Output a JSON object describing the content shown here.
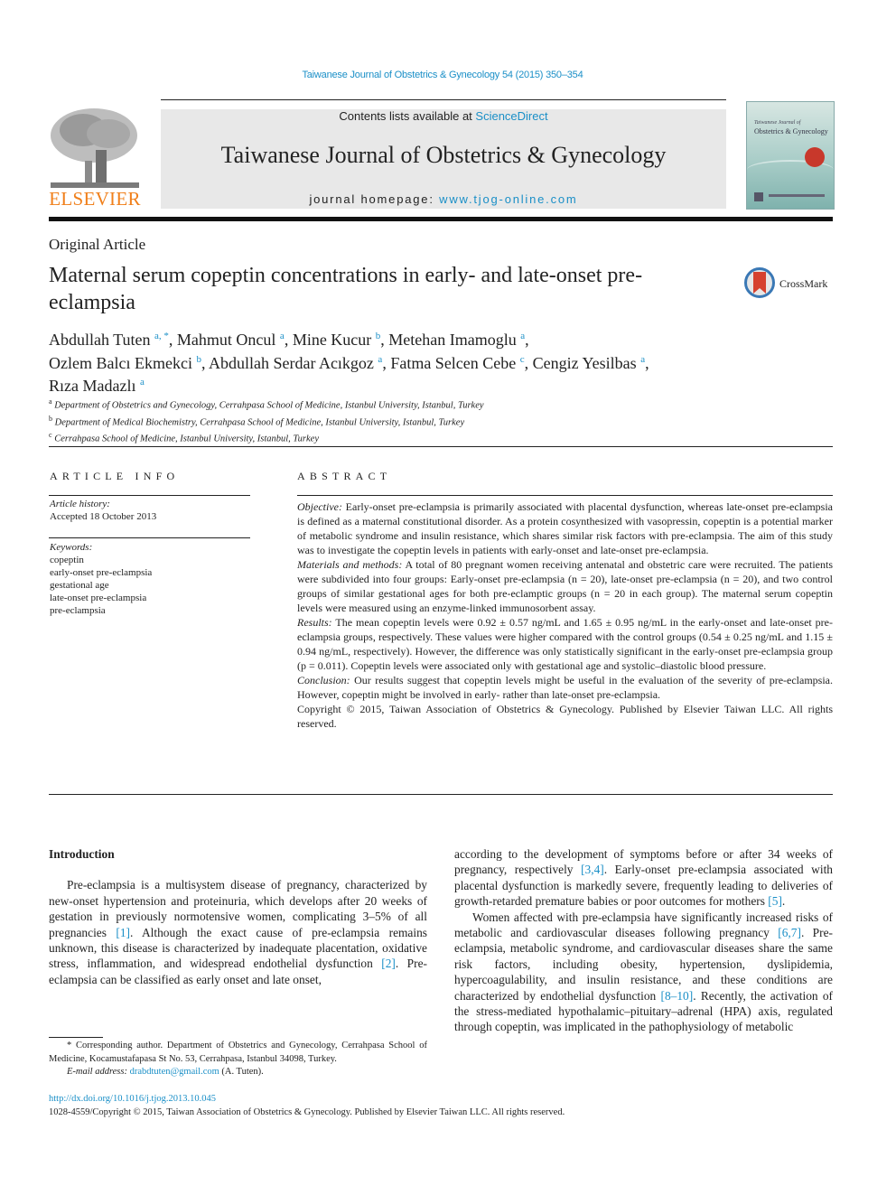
{
  "running_head": "Taiwanese Journal of Obstetrics & Gynecology 54 (2015) 350–354",
  "header": {
    "publisher_logo_text": "ELSEVIER",
    "contents_prefix": "Contents lists available at ",
    "contents_link": "ScienceDirect",
    "journal_title": "Taiwanese Journal of Obstetrics & Gynecology",
    "homepage_prefix": "journal homepage: ",
    "homepage_link": "www.tjog-online.com",
    "cover_small": "Taiwanese Journal of",
    "cover_title": "Obstetrics & Gynecology"
  },
  "article": {
    "type": "Original Article",
    "title": "Maternal serum copeptin concentrations in early- and late-onset pre-eclampsia",
    "crossmark_label": "CrossMark",
    "authors": [
      {
        "name": "Abdullah Tuten",
        "sup": "a, *",
        "sep": ", "
      },
      {
        "name": "Mahmut Oncul",
        "sup": "a",
        "sep": ", "
      },
      {
        "name": "Mine Kucur",
        "sup": "b",
        "sep": ", "
      },
      {
        "name": "Metehan Imamoglu",
        "sup": "a",
        "sep": ","
      },
      {
        "name": "Ozlem Balcı Ekmekci",
        "sup": "b",
        "sep": ", "
      },
      {
        "name": "Abdullah Serdar Acıkgoz",
        "sup": "a",
        "sep": ", "
      },
      {
        "name": "Fatma Selcen Cebe",
        "sup": "c",
        "sep": ", "
      },
      {
        "name": "Cengiz Yesilbas",
        "sup": "a",
        "sep": ","
      },
      {
        "name": "Rıza Madazlı",
        "sup": "a",
        "sep": ""
      }
    ],
    "affiliations": [
      {
        "sup": "a",
        "text": "Department of Obstetrics and Gynecology, Cerrahpasa School of Medicine, Istanbul University, Istanbul, Turkey"
      },
      {
        "sup": "b",
        "text": "Department of Medical Biochemistry, Cerrahpasa School of Medicine, Istanbul University, Istanbul, Turkey"
      },
      {
        "sup": "c",
        "text": "Cerrahpasa School of Medicine, Istanbul University, Istanbul, Turkey"
      }
    ]
  },
  "article_info": {
    "heading": "ARTICLE INFO",
    "history_label": "Article history:",
    "history_value": "Accepted 18 October 2013",
    "keywords_label": "Keywords:",
    "keywords": [
      "copeptin",
      "early-onset pre-eclampsia",
      "gestational age",
      "late-onset pre-eclampsia",
      "pre-eclampsia"
    ]
  },
  "abstract": {
    "heading": "ABSTRACT",
    "objective_label": "Objective:",
    "objective": " Early-onset pre-eclampsia is primarily associated with placental dysfunction, whereas late-onset pre-eclampsia is defined as a maternal constitutional disorder. As a protein cosynthesized with vasopressin, copeptin is a potential marker of metabolic syndrome and insulin resistance, which shares similar risk factors with pre-eclampsia. The aim of this study was to investigate the copeptin levels in patients with early-onset and late-onset pre-eclampsia.",
    "methods_label": "Materials and methods:",
    "methods": " A total of 80 pregnant women receiving antenatal and obstetric care were recruited. The patients were subdivided into four groups: Early-onset pre-eclampsia (n = 20), late-onset pre-eclampsia (n = 20), and two control groups of similar gestational ages for both pre-eclamptic groups (n = 20 in each group). The maternal serum copeptin levels were measured using an enzyme-linked immunosorbent assay.",
    "results_label": "Results:",
    "results": " The mean copeptin levels were 0.92 ± 0.57 ng/mL and 1.65 ± 0.95 ng/mL in the early-onset and late-onset pre-eclampsia groups, respectively. These values were higher compared with the control groups (0.54 ± 0.25 ng/mL and 1.15 ± 0.94 ng/mL, respectively). However, the difference was only statistically significant in the early-onset pre-eclampsia group (p = 0.011). Copeptin levels were associated only with gestational age and systolic–diastolic blood pressure.",
    "conclusion_label": "Conclusion:",
    "conclusion": " Our results suggest that copeptin levels might be useful in the evaluation of the severity of pre-eclampsia. However, copeptin might be involved in early- rather than late-onset pre-eclampsia.",
    "copyright": "Copyright © 2015, Taiwan Association of Obstetrics & Gynecology. Published by Elsevier Taiwan LLC. All rights reserved."
  },
  "body": {
    "intro_heading": "Introduction",
    "col1_p1_a": "Pre-eclampsia is a multisystem disease of pregnancy, characterized by new-onset hypertension and proteinuria, which develops after 20 weeks of gestation in previously normotensive women, complicating 3–5% of all pregnancies ",
    "ref1": "[1]",
    "col1_p1_b": ". Although the exact cause of pre-eclampsia remains unknown, this disease is characterized by inadequate placentation, oxidative stress, inflammation, and widespread endothelial dysfunction ",
    "ref2": "[2]",
    "col1_p1_c": ". Pre-eclampsia can be classified as early onset and late onset,",
    "col2_p1_a": "according to the development of symptoms before or after 34 weeks of pregnancy, respectively ",
    "ref3": "[3,4]",
    "col2_p1_b": ". Early-onset pre-eclampsia associated with placental dysfunction is markedly severe, frequently leading to deliveries of growth-retarded premature babies or poor outcomes for mothers ",
    "ref4": "[5]",
    "col2_p1_c": ".",
    "col2_p2_a": "Women affected with pre-eclampsia have significantly increased risks of metabolic and cardiovascular diseases following pregnancy ",
    "ref5": "[6,7]",
    "col2_p2_b": ". Pre-eclampsia, metabolic syndrome, and cardiovascular diseases share the same risk factors, including obesity, hypertension, dyslipidemia, hypercoagulability, and insulin resistance, and these conditions are characterized by endothelial dysfunction ",
    "ref6": "[8–10]",
    "col2_p2_c": ". Recently, the activation of the stress-mediated hypothalamic–pituitary–adrenal (HPA) axis, regulated through copeptin, was implicated in the pathophysiology of metabolic"
  },
  "footnote": {
    "corresponding": "* Corresponding author. Department of Obstetrics and Gynecology, Cerrahpasa School of Medicine, Kocamustafapasa St No. 53, Cerrahpasa, Istanbul 34098, Turkey.",
    "email_label": "E-mail address: ",
    "email": "drabdtuten@gmail.com",
    "email_suffix": " (A. Tuten)."
  },
  "footer": {
    "doi": "http://dx.doi.org/10.1016/j.tjog.2013.10.045",
    "copyright": "1028-4559/Copyright © 2015, Taiwan Association of Obstetrics & Gynecology. Published by Elsevier Taiwan LLC. All rights reserved."
  }
}
